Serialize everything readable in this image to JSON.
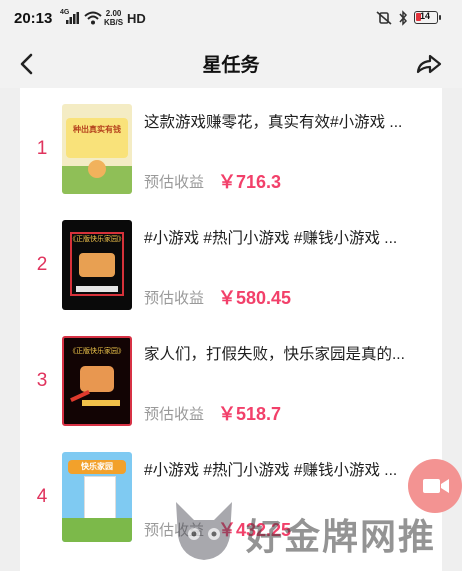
{
  "status_bar": {
    "time": "20:13",
    "signal": "4G",
    "net_speed_value": "2.00",
    "net_speed_unit": "KB/S",
    "hd": "HD",
    "battery": "14"
  },
  "header": {
    "title": "星任务"
  },
  "tasks": [
    {
      "rank": "1",
      "title": "这款游戏赚零花，真实有效#小游戏 ...",
      "earn_label": "预估收益",
      "earn_value": "￥716.3"
    },
    {
      "rank": "2",
      "title": "#小游戏 #热门小游戏 #赚钱小游戏 ...",
      "earn_label": "预估收益",
      "earn_value": "￥580.45"
    },
    {
      "rank": "3",
      "title": "家人们，打假失败，快乐家园是真的...",
      "earn_label": "预估收益",
      "earn_value": "￥518.7"
    },
    {
      "rank": "4",
      "title": "#小游戏 #热门小游戏 #赚钱小游戏 ...",
      "earn_label": "预估收益",
      "earn_value": "￥432.25"
    }
  ],
  "thumbnails": {
    "t1_text": "种出真实有钱",
    "t2_header": "《正版快乐家园》",
    "t3_header": "《正版快乐家园》",
    "t4_logo": "快乐家园"
  },
  "watermark": {
    "text": "好金牌网推"
  },
  "colors": {
    "accent": "#f2406a",
    "rank": "#e0335d",
    "fab": "#f39392"
  }
}
